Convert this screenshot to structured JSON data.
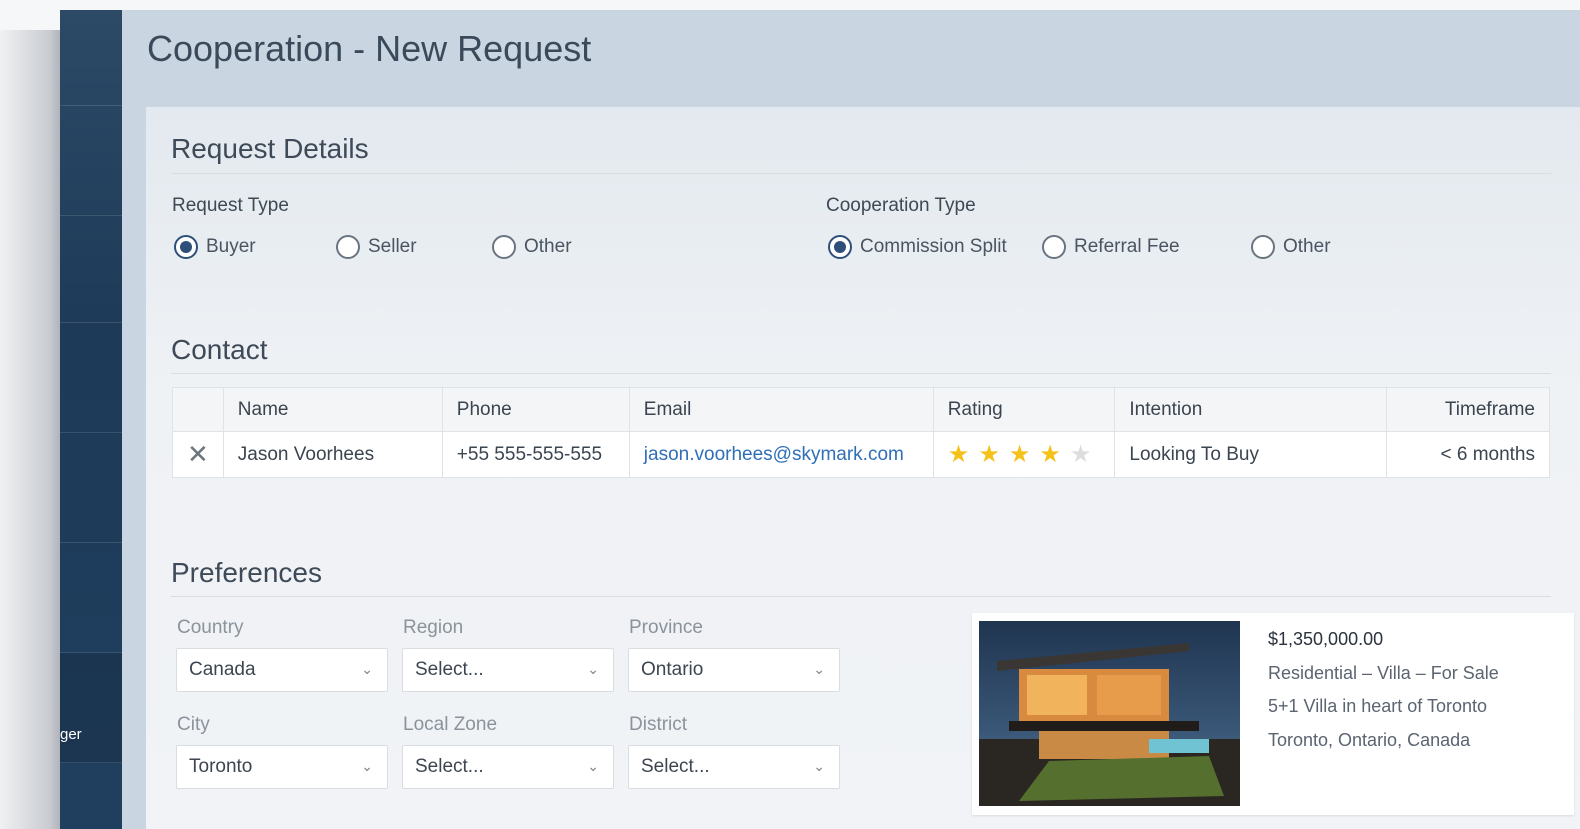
{
  "page": {
    "title": "Cooperation - New Request"
  },
  "sidebar": {
    "partial_label": "ger"
  },
  "request_details": {
    "heading": "Request Details",
    "request_type": {
      "label": "Request Type",
      "options": [
        "Buyer",
        "Seller",
        "Other"
      ],
      "selected": "Buyer"
    },
    "cooperation_type": {
      "label": "Cooperation Type",
      "options": [
        "Commission Split",
        "Referral Fee",
        "Other"
      ],
      "selected": "Commission Split"
    }
  },
  "contact": {
    "heading": "Contact",
    "columns": [
      "Name",
      "Phone",
      "Email",
      "Rating",
      "Intention",
      "Timeframe"
    ],
    "rows": [
      {
        "name": "Jason Voorhees",
        "phone": "+55 555-555-555",
        "email": "jason.voorhees@skymark.com",
        "rating": 4,
        "rating_max": 5,
        "intention": "Looking To Buy",
        "timeframe": "< 6 months"
      }
    ]
  },
  "preferences": {
    "heading": "Preferences",
    "fields": {
      "country": {
        "label": "Country",
        "value": "Canada"
      },
      "region": {
        "label": "Region",
        "value": "Select..."
      },
      "province": {
        "label": "Province",
        "value": "Ontario"
      },
      "city": {
        "label": "City",
        "value": "Toronto"
      },
      "local_zone": {
        "label": "Local Zone",
        "value": "Select..."
      },
      "district": {
        "label": "District",
        "value": "Select..."
      }
    }
  },
  "listing_card": {
    "price": "$1,350,000.00",
    "category": "Residential – Villa – For Sale",
    "description": "5+1 Villa in heart of Toronto",
    "location": "Toronto, Ontario, Canada"
  },
  "colors": {
    "accent": "#2d4f7a",
    "link": "#2f6fb8",
    "star": "#f4c21b",
    "header_bg": "#c9d6e2"
  }
}
